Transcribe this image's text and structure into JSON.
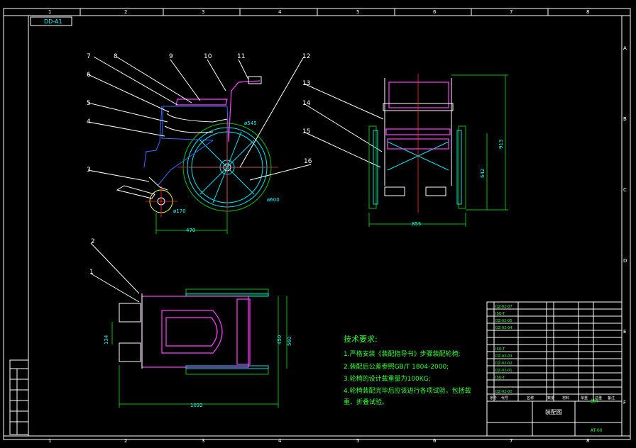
{
  "title_tag": "DD-A1",
  "border": {
    "columns": [
      "1",
      "2",
      "3",
      "4",
      "5",
      "6",
      "7",
      "8"
    ],
    "rows": [
      "A",
      "B",
      "C",
      "D",
      "E",
      "F"
    ]
  },
  "balloons": [
    "1",
    "2",
    "3",
    "4",
    "5",
    "6",
    "7",
    "8",
    "9",
    "10",
    "11",
    "12",
    "13",
    "14",
    "15",
    "16"
  ],
  "dimensions": {
    "front_wheel_dia": "ø170",
    "rear_wheel_dia": "ø600",
    "handrim_dia": "ø545",
    "wheel_base": "470",
    "side_width": "855",
    "front_height_small": "642",
    "front_height_total": "913",
    "top_width_small": "450",
    "top_width_total": "560",
    "top_length": "1032",
    "footrest": "134"
  },
  "tech": {
    "heading": "技术要求:",
    "items": [
      "1.严格安装《装配指导书》步骤装配轮椅;",
      "2.装配后公差参照GB/T 1804-2000;",
      "3.轮椅的设计载重量为100KG;",
      "4.轮椅装配完毕后应该进行各项试验，包括载",
      "重、折叠试验。"
    ]
  },
  "title_block": {
    "drawing_name": "装配图",
    "drawing_no": "AT-00",
    "material_label": "组件"
  },
  "bom_codes": [
    "DZ-02-07",
    "ISO-T",
    "DZ-02-05",
    "DZ-02-04",
    "ISO-T",
    "DZ-02-03",
    "DZ-02-02",
    "DZ-02-01",
    "ISO-T",
    "DZ-02-00"
  ],
  "header_labels": [
    "序号",
    "代号",
    "名称",
    "数量",
    "材料",
    "单重",
    "总重",
    "备注"
  ]
}
